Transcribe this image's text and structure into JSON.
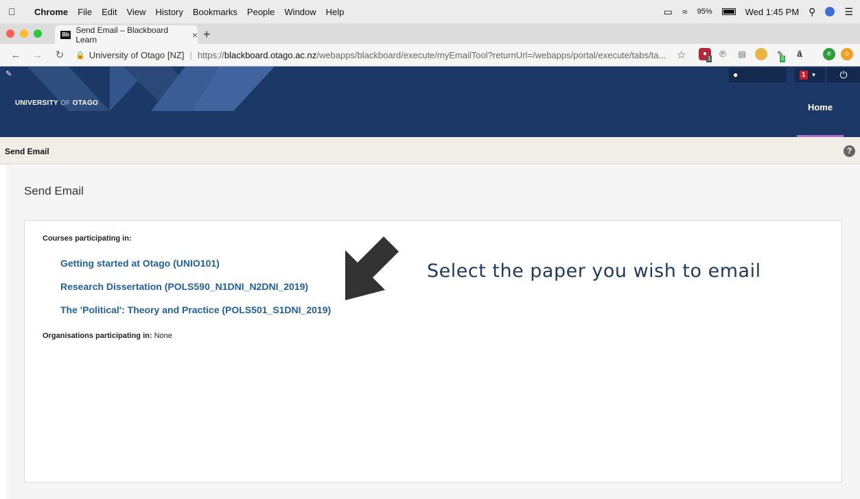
{
  "menubar": {
    "app": "Chrome",
    "items": [
      "File",
      "Edit",
      "View",
      "History",
      "Bookmarks",
      "People",
      "Window",
      "Help"
    ],
    "battery": "95%",
    "clock": "Wed 1:45 PM"
  },
  "browser": {
    "tab_title": "Send Email – Blackboard Learn",
    "favicon_text": "Bb",
    "site_label": "University of Otago [NZ]",
    "url_prefix": "https://",
    "url_host": "blackboard.otago.ac.nz",
    "url_path": "/webapps/blackboard/execute/myEmailTool?returnUrl=/webapps/portal/execute/tabs/ta...",
    "ext_badge_1": "1",
    "ext_badge_2": "0"
  },
  "header": {
    "logo_main": "UNIVERSITY",
    "logo_of": " OF ",
    "logo_end": "OTAGO",
    "notification_count": "1",
    "home_tab": "Home",
    "colors": {
      "navy": "#1c3866",
      "accent": "#b06ec9"
    }
  },
  "page": {
    "bar_title": "Send Email",
    "heading": "Send Email",
    "courses_label": "Courses participating in:",
    "courses": [
      "Getting started at Otago (UNIO101)",
      "Research Dissertation (POLS590_N1DNI_N2DNI_2019)",
      "The 'Political': Theory and Practice (POLS501_S1DNI_2019)"
    ],
    "orgs_label": "Organisations participating in:",
    "orgs_value": " None",
    "annotation": "Select the paper you wish to email"
  }
}
